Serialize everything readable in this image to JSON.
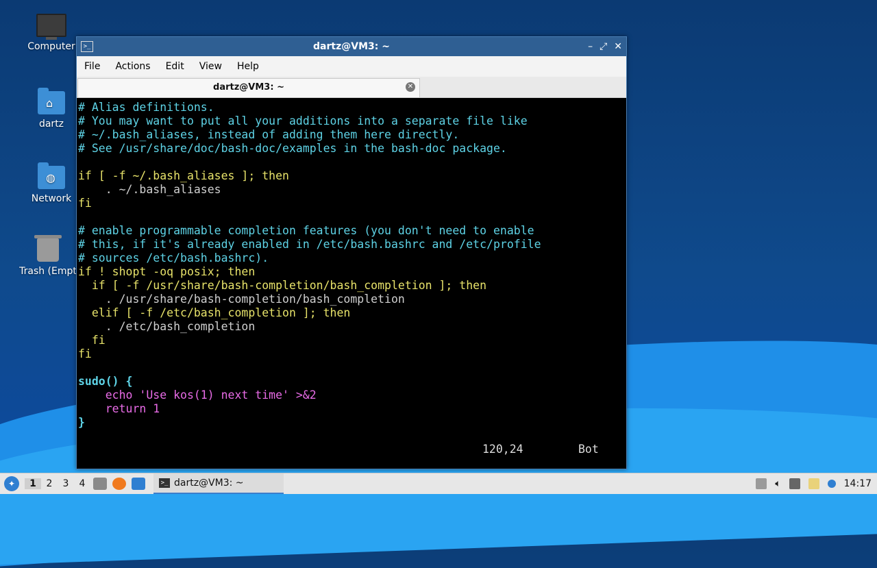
{
  "desktop": {
    "icons": [
      {
        "label": "Computer"
      },
      {
        "label": "dartz"
      },
      {
        "label": "Network"
      },
      {
        "label": "Trash (Empt"
      }
    ]
  },
  "window": {
    "title": "dartz@VM3: ~",
    "app_icon": ">_",
    "controls": {
      "minimize": "–",
      "maximize": "⤢",
      "close": "✕"
    },
    "menu": [
      "File",
      "Actions",
      "Edit",
      "View",
      "Help"
    ],
    "tab_title": "dartz@VM3: ~",
    "tab_close": "✕"
  },
  "terminal": {
    "lines": [
      "# Alias definitions.",
      "# You may want to put all your additions into a separate file like",
      "# ~/.bash_aliases, instead of adding them here directly.",
      "# See /usr/share/doc/bash-doc/examples in the bash-doc package.",
      "",
      "if [ -f ~/.bash_aliases ]; then",
      "    . ~/.bash_aliases",
      "fi",
      "",
      "# enable programmable completion features (you don't need to enable",
      "# this, if it's already enabled in /etc/bash.bashrc and /etc/profile",
      "# sources /etc/bash.bashrc).",
      "if ! shopt -oq posix; then",
      "  if [ -f /usr/share/bash-completion/bash_completion ]; then",
      "    . /usr/share/bash-completion/bash_completion",
      "  elif [ -f /etc/bash_completion ]; then",
      "    . /etc/bash_completion",
      "  fi",
      "fi",
      "",
      "sudo() {",
      "    echo 'Use kos(1) next time' >&2",
      "    return 1",
      "}"
    ],
    "cursor_position": "120,24",
    "scroll_indicator": "Bot"
  },
  "taskbar": {
    "workspaces": [
      "1",
      "2",
      "3",
      "4"
    ],
    "active_workspace": "1",
    "task_label": "dartz@VM3: ~",
    "clock": "14:17"
  }
}
